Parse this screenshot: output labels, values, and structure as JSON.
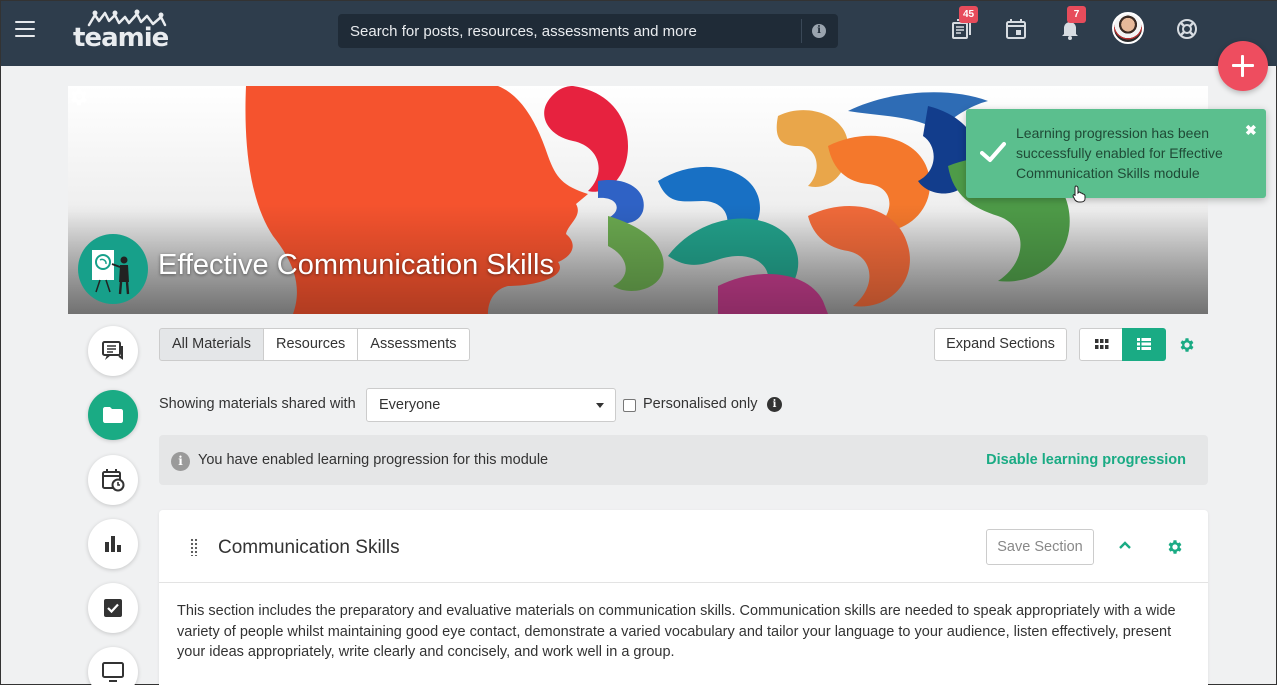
{
  "header": {
    "logo_text": "teamie",
    "search_placeholder": "Search for posts, resources, assessments and more",
    "library_badge": "45",
    "notifications_badge": "7"
  },
  "banner": {
    "course_title": "Effective Communication Skills"
  },
  "toast": {
    "message": "Learning progression has been successfully enabled for Effective Communication Skills module",
    "close_symbol": "✖"
  },
  "filters": {
    "tabs": [
      "All Materials",
      "Resources",
      "Assessments"
    ],
    "expand_label": "Expand Sections",
    "shared_label": "Showing materials shared with",
    "shared_value": "Everyone",
    "personalised_label": "Personalised only"
  },
  "notice": {
    "text": "You have enabled learning progression for this module",
    "link": "Disable learning progression"
  },
  "section": {
    "title": "Communication Skills",
    "save_label": "Save Section",
    "description": "This section includes the preparatory and evaluative materials on communication skills. Communication skills are needed to speak appropriately with a wide variety of people whilst maintaining good eye contact, demonstrate a varied vocabulary and tailor your language to your audience, listen effectively, present your ideas appropriately, write clearly and concisely, and work well in a group."
  },
  "colors": {
    "topbar": "#2e3d4c",
    "accent": "#1aab84",
    "fab": "#ee4d5f",
    "toast": "#5bbf8e"
  }
}
